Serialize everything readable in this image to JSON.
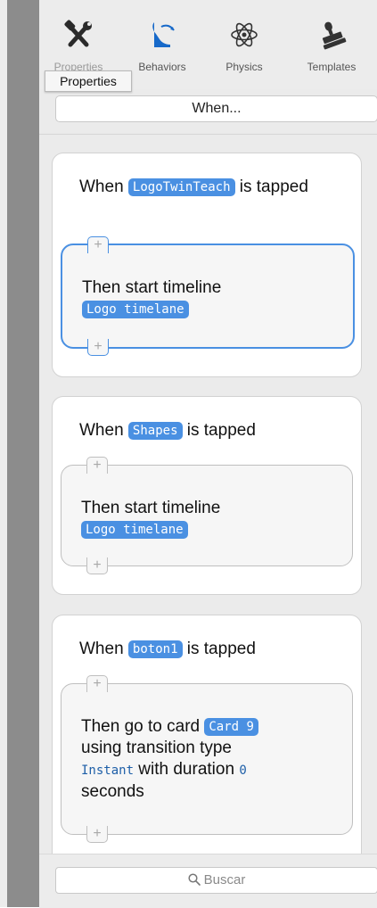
{
  "toolbar": {
    "items": [
      {
        "label": "Properties",
        "icon": "tools-icon"
      },
      {
        "label": "Behaviors",
        "icon": "behaviors-icon"
      },
      {
        "label": "Physics",
        "icon": "atom-icon"
      },
      {
        "label": "Templates",
        "icon": "stamp-icon"
      }
    ],
    "tooltip": "Properties"
  },
  "when_button": {
    "label": "When..."
  },
  "behaviors": [
    {
      "when_prefix": "When",
      "trigger_object": "LogoTwinTeach",
      "when_suffix": "is tapped",
      "action_prefix": "Then start timeline",
      "action_token": "Logo timelane",
      "selected": true
    },
    {
      "when_prefix": "When",
      "trigger_object": "Shapes",
      "when_suffix": "is tapped",
      "action_prefix": "Then start timeline",
      "action_token": "Logo timelane",
      "selected": false
    },
    {
      "when_prefix": "When",
      "trigger_object": "boton1",
      "when_suffix": "is tapped",
      "action_prefix": "Then go to card",
      "action_token": "Card 9",
      "action_middle": "using transition type",
      "transition": "Instant",
      "duration_label": "with duration",
      "duration": "0",
      "duration_suffix": "seconds",
      "selected": false
    }
  ],
  "plus_glyph": "+",
  "search": {
    "placeholder": "Buscar"
  },
  "colors": {
    "accent": "#4a90e2",
    "panel": "#ebebeb",
    "gutter": "#8c8c8c"
  }
}
